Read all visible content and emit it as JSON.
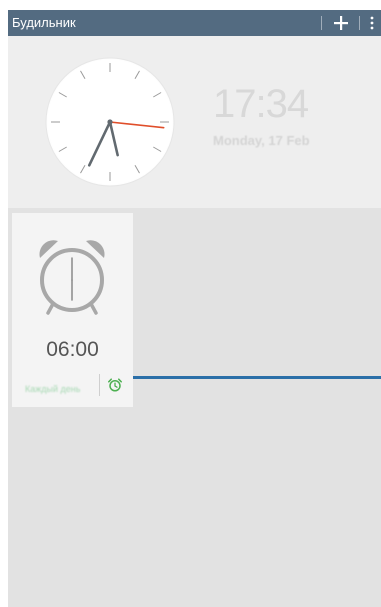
{
  "header": {
    "title": "Будильник",
    "add_icon": "plus-icon",
    "menu_icon": "more-vertical-icon"
  },
  "clock": {
    "digital_time": "17:34",
    "date": "Monday, 17 Feb",
    "analog_hours": 17,
    "analog_minutes": 34,
    "analog_seconds": 16
  },
  "alarm": {
    "icon": "alarm-clock-icon",
    "time": "06:00",
    "repeat_label": "Каждый день",
    "toggle_icon": "alarm-on-icon",
    "enabled": true
  },
  "colors": {
    "header_background": "#536b81",
    "accent_green": "#4caf50",
    "second_hand": "#e04e2a",
    "callout_line": "#2b6fa8"
  }
}
